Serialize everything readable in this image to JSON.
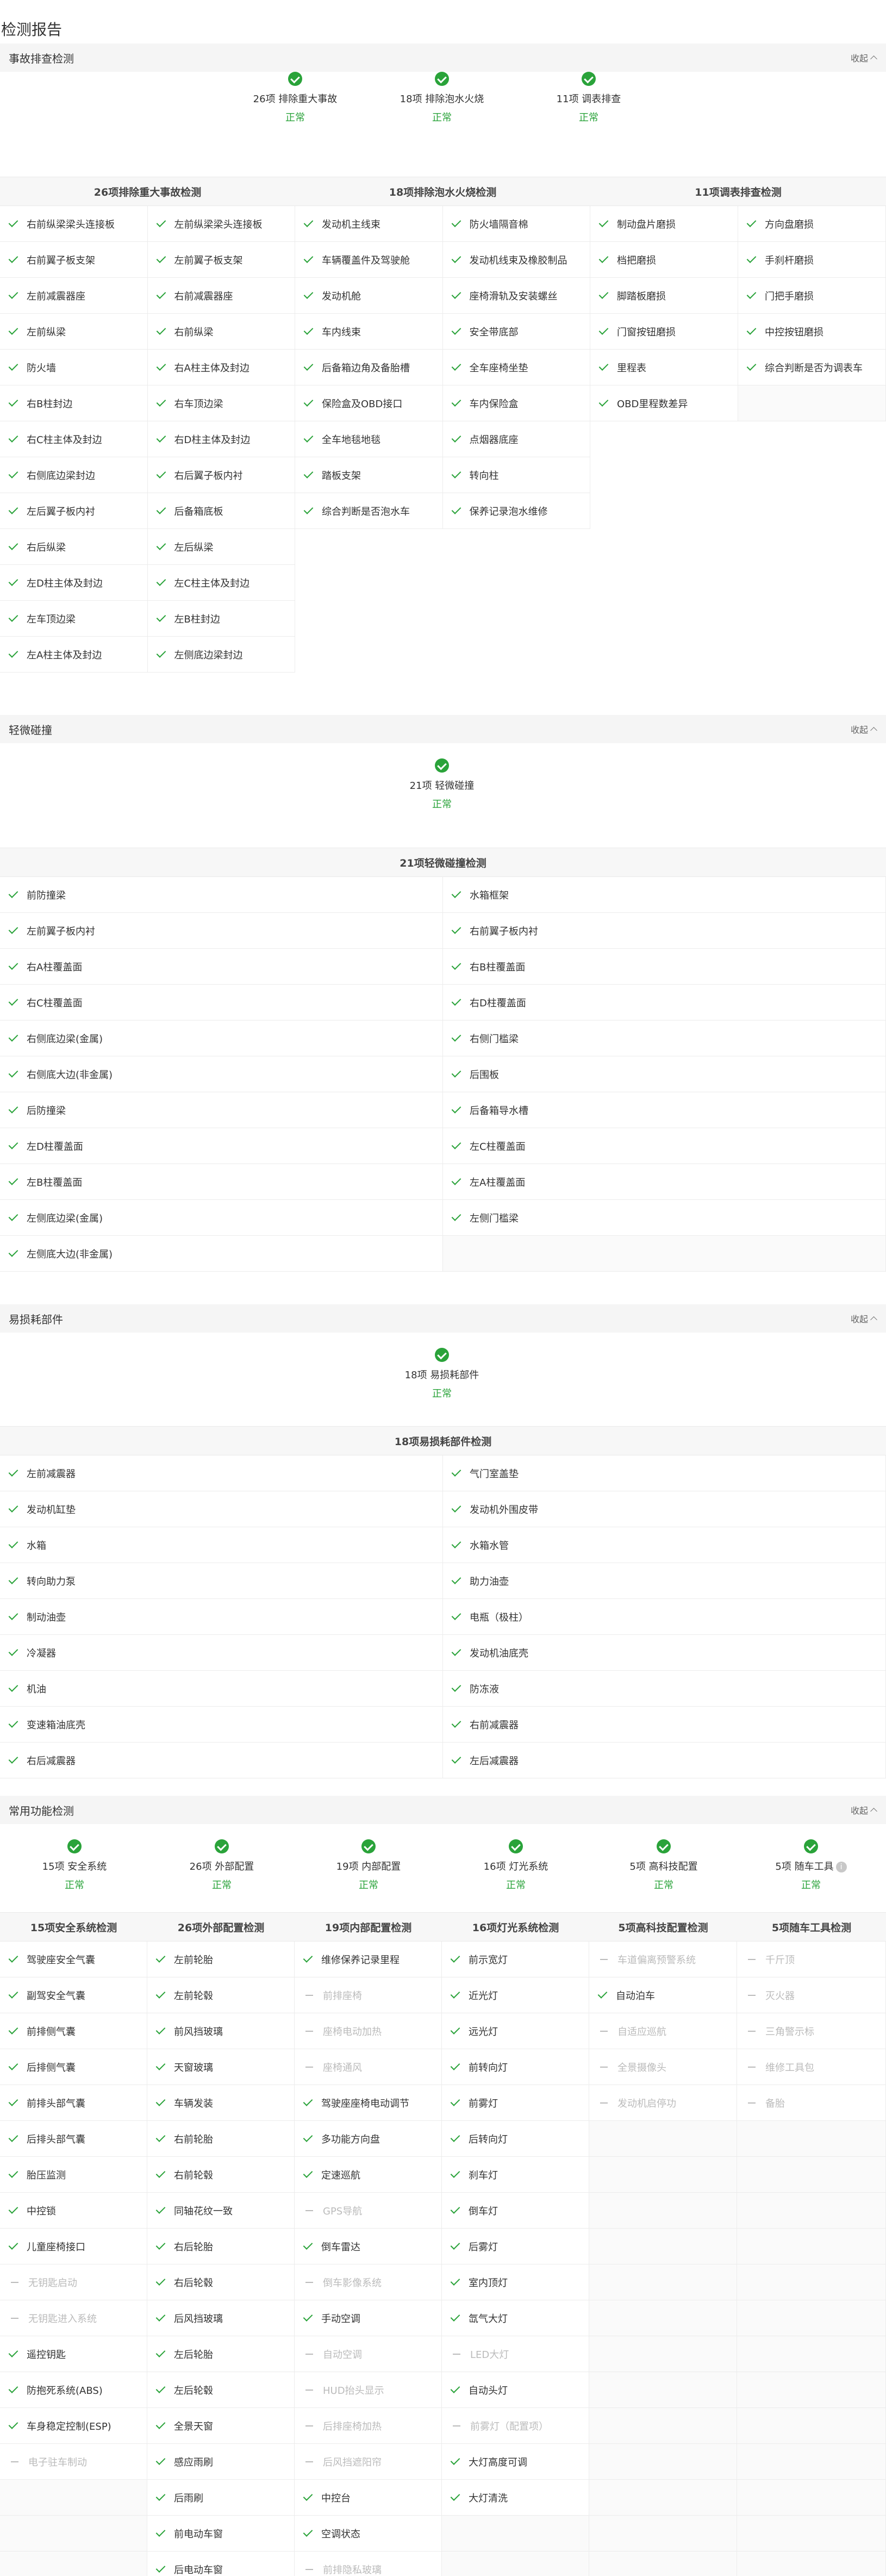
{
  "page_title": "检测报告",
  "collapse_label": "收起",
  "accident": {
    "title": "事故排查检测",
    "summary": [
      {
        "label": "26项 排除重大事故",
        "status": "正常"
      },
      {
        "label": "18项 排除泡水火烧",
        "status": "正常"
      },
      {
        "label": "11项 调表排查",
        "status": "正常"
      }
    ],
    "groups": [
      {
        "title": "26项排除重大事故检测",
        "items": [
          "右前纵梁梁头连接板",
          "左前纵梁梁头连接板",
          "右前翼子板支架",
          "左前翼子板支架",
          "左前减震器座",
          "右前减震器座",
          "左前纵梁",
          "右前纵梁",
          "防火墙",
          "右A柱主体及封边",
          "右B柱封边",
          "右车顶边梁",
          "右C柱主体及封边",
          "右D柱主体及封边",
          "右侧底边梁封边",
          "右后翼子板内衬",
          "左后翼子板内衬",
          "后备箱底板",
          "右后纵梁",
          "左后纵梁",
          "左D柱主体及封边",
          "左C柱主体及封边",
          "左车顶边梁",
          "左B柱封边",
          "左A柱主体及封边",
          "左侧底边梁封边"
        ]
      },
      {
        "title": "18项排除泡水火烧检测",
        "items": [
          "发动机主线束",
          "防火墙隔音棉",
          "车辆覆盖件及驾驶舱",
          "发动机线束及橡胶制品",
          "发动机舱",
          "座椅滑轨及安装螺丝",
          "车内线束",
          "安全带底部",
          "后备箱边角及备胎槽",
          "全车座椅坐垫",
          "保险盒及OBD接口",
          "车内保险盒",
          "全车地毯地毯",
          "点烟器底座",
          "踏板支架",
          "转向柱",
          "综合判断是否泡水车",
          "保养记录泡水维修"
        ]
      },
      {
        "title": "11项调表排查检测",
        "items": [
          "制动盘片磨损",
          "方向盘磨损",
          "档把磨损",
          "手刹杆磨损",
          "脚踏板磨损",
          "门把手磨损",
          "门窗按钮磨损",
          "中控按钮磨损",
          "里程表",
          "综合判断是否为调表车",
          "OBD里程数差异"
        ]
      }
    ]
  },
  "minor": {
    "title": "轻微碰撞",
    "summary": [
      {
        "label": "21项 轻微碰撞",
        "status": "正常"
      }
    ],
    "group": {
      "title": "21项轻微碰撞检测",
      "items": [
        "前防撞梁",
        "水箱框架",
        "左前翼子板内衬",
        "右前翼子板内衬",
        "右A柱覆盖面",
        "右B柱覆盖面",
        "右C柱覆盖面",
        "右D柱覆盖面",
        "右侧底边梁(金属)",
        "右侧门槛梁",
        "右侧底大边(非金属)",
        "后围板",
        "后防撞梁",
        "后备箱导水槽",
        "左D柱覆盖面",
        "左C柱覆盖面",
        "左B柱覆盖面",
        "左A柱覆盖面",
        "左侧底边梁(金属)",
        "左侧门槛梁",
        "左侧底大边(非金属)"
      ]
    }
  },
  "wear": {
    "title": "易损耗部件",
    "summary": [
      {
        "label": "18项 易损耗部件",
        "status": "正常"
      }
    ],
    "group": {
      "title": "18项易损耗部件检测",
      "items": [
        "左前减震器",
        "气门室盖垫",
        "发动机缸垫",
        "发动机外围皮带",
        "水箱",
        "水箱水管",
        "转向助力泵",
        "助力油壶",
        "制动油壶",
        "电瓶（极柱）",
        "冷凝器",
        "发动机油底壳",
        "机油",
        "防冻液",
        "变速箱油底壳",
        "右前减震器",
        "右后减震器",
        "左后减震器"
      ]
    }
  },
  "functions": {
    "title": "常用功能检测",
    "summary": [
      {
        "label": "15项 安全系统",
        "status": "正常"
      },
      {
        "label": "26项 外部配置",
        "status": "正常"
      },
      {
        "label": "19项 内部配置",
        "status": "正常"
      },
      {
        "label": "16项 灯光系统",
        "status": "正常"
      },
      {
        "label": "5项 高科技配置",
        "status": "正常"
      },
      {
        "label": "5项 随车工具",
        "status": "正常",
        "info": "i"
      }
    ],
    "columns": [
      {
        "title": "15项安全系统检测",
        "items": [
          [
            "驾驶座安全气囊",
            1
          ],
          [
            "副驾安全气囊",
            1
          ],
          [
            "前排侧气囊",
            1
          ],
          [
            "后排侧气囊",
            1
          ],
          [
            "前排头部气囊",
            1
          ],
          [
            "后排头部气囊",
            1
          ],
          [
            "胎压监测",
            1
          ],
          [
            "中控锁",
            1
          ],
          [
            "儿童座椅接口",
            1
          ],
          [
            "无钥匙启动",
            0
          ],
          [
            "无钥匙进入系统",
            0
          ],
          [
            "遥控钥匙",
            1
          ],
          [
            "防抱死系统(ABS)",
            1
          ],
          [
            "车身稳定控制(ESP)",
            1
          ],
          [
            "电子驻车制动",
            0
          ]
        ]
      },
      {
        "title": "26项外部配置检测",
        "items": [
          [
            "左前轮胎",
            1
          ],
          [
            "左前轮毂",
            1
          ],
          [
            "前风挡玻璃",
            1
          ],
          [
            "天窗玻璃",
            1
          ],
          [
            "车辆发装",
            1
          ],
          [
            "右前轮胎",
            1
          ],
          [
            "右前轮毂",
            1
          ],
          [
            "同轴花纹一致",
            1
          ],
          [
            "右后轮胎",
            1
          ],
          [
            "右后轮毂",
            1
          ],
          [
            "后风挡玻璃",
            1
          ],
          [
            "左后轮胎",
            1
          ],
          [
            "左后轮毂",
            1
          ],
          [
            "全景天窗",
            1
          ],
          [
            "感应雨刷",
            1
          ],
          [
            "后雨刷",
            1
          ],
          [
            "前电动车窗",
            1
          ],
          [
            "后电动车窗",
            1
          ]
        ]
      },
      {
        "title": "19项内部配置检测",
        "items": [
          [
            "维修保养记录里程",
            1
          ],
          [
            "前排座椅",
            0
          ],
          [
            "座椅电动加热",
            0
          ],
          [
            "座椅通风",
            0
          ],
          [
            "驾驶座座椅电动调节",
            1
          ],
          [
            "多功能方向盘",
            1
          ],
          [
            "定速巡航",
            1
          ],
          [
            "GPS导航",
            0
          ],
          [
            "倒车雷达",
            1
          ],
          [
            "倒车影像系统",
            0
          ],
          [
            "手动空调",
            1
          ],
          [
            "自动空调",
            0
          ],
          [
            "HUD抬头显示",
            0
          ],
          [
            "后排座椅加热",
            0
          ],
          [
            "后风挡遮阳帘",
            0
          ],
          [
            "中控台",
            1
          ],
          [
            "空调状态",
            1
          ],
          [
            "前排隐私玻璃",
            0
          ]
        ]
      },
      {
        "title": "16项灯光系统检测",
        "items": [
          [
            "前示宽灯",
            1
          ],
          [
            "近光灯",
            1
          ],
          [
            "远光灯",
            1
          ],
          [
            "前转向灯",
            1
          ],
          [
            "前雾灯",
            1
          ],
          [
            "后转向灯",
            1
          ],
          [
            "刹车灯",
            1
          ],
          [
            "倒车灯",
            1
          ],
          [
            "后雾灯",
            1
          ],
          [
            "室内顶灯",
            1
          ],
          [
            "氙气大灯",
            1
          ],
          [
            "LED大灯",
            0
          ],
          [
            "自动头灯",
            1
          ],
          [
            "前雾灯（配置项）",
            0
          ],
          [
            "大灯高度可调",
            1
          ],
          [
            "大灯清洗",
            1
          ]
        ]
      },
      {
        "title": "5项高科技配置检测",
        "items": [
          [
            "车道偏离预警系统",
            0
          ],
          [
            "自动泊车",
            1
          ],
          [
            "自适应巡航",
            0
          ],
          [
            "全景摄像头",
            0
          ],
          [
            "发动机启停功",
            0
          ]
        ]
      },
      {
        "title": "5项随车工具检测",
        "items": [
          [
            "千斤顶",
            0
          ],
          [
            "灭火器",
            0
          ],
          [
            "三角警示标",
            0
          ],
          [
            "维修工具包",
            0
          ],
          [
            "备胎",
            0
          ]
        ]
      }
    ]
  }
}
